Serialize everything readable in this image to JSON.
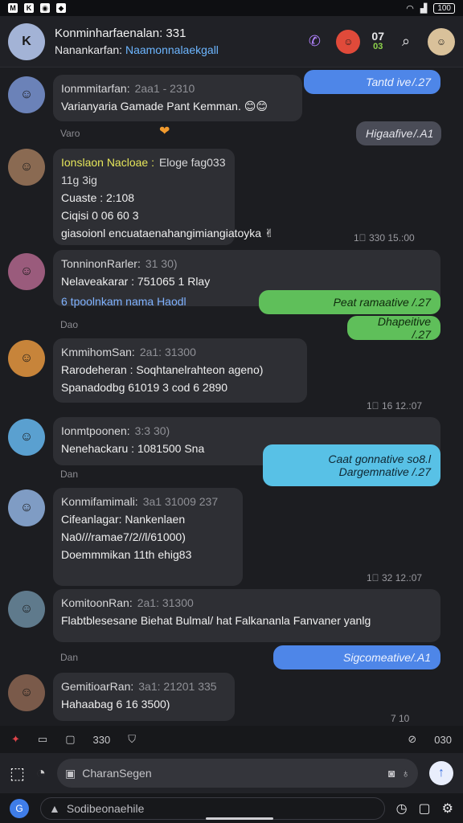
{
  "statusbar": {
    "icons": [
      "notification-icon",
      "notification-icon",
      "notification-icon",
      "notification-icon"
    ],
    "battery": "100"
  },
  "header": {
    "title": "Konminharfaenalan: 331",
    "subtitle_prefix": "Nanankarfan:",
    "subtitle_accent": "Naamonnalaekgall",
    "badge_top": "07",
    "badge_bottom": "03",
    "avatar_initials": "K"
  },
  "messages": [
    {
      "name": "Ionmmitarfan:",
      "time": "2aa1 - 2310",
      "lines": [
        "Varianyaria Gamade Pant Kemman. 😊😊"
      ]
    },
    {
      "name": "Ionslaon Nacloae :",
      "time": "Eloge fag033   11g 3ig",
      "lines": [
        "Cuaste : 2:108",
        "Ciqisi 0 06 60 3",
        "giasoionl encuataenahangimiangiatoyka ✌"
      ],
      "meta": "1⃝ 330 15.:00"
    },
    {
      "name": "TonninonRarler:",
      "time": "31 30)",
      "lines": [
        "Nelaveakarar : 751065 1 Rlay",
        "6 tpoolnkam nama Haodl"
      ]
    },
    {
      "name": "KmmihomSan:",
      "time": "2a1: 31300",
      "lines": [
        "Rarodeheran : Soqhtanelrahteon ageno)",
        "Spanadodbg 61019 3 cod 6 2890"
      ],
      "meta": "1⃝ 16 12.:07"
    },
    {
      "name": "Ionmtpoonen:",
      "time": "3:3 30)",
      "lines": [
        "Nenehackaru : 1081500 Sna"
      ]
    },
    {
      "name": "Konmifamimali:",
      "time": "3a1 31009 237",
      "lines": [
        "Cifeanlagar: Nankenlaen",
        "Na0///ramae7/2//l/61000)",
        "Doemmmikan 11th ehig83"
      ],
      "meta": "1⃝ 32 12.:07"
    },
    {
      "name": "KomitoonRan:",
      "time": "2a1: 31300",
      "lines": [
        "Flabtblesesane Biehat Bulmal/ hat Falkananla Fanvaner yanlg"
      ]
    },
    {
      "name": "GemitioarRan:",
      "time": "3a1: 21201 335",
      "lines": [
        "Hahaabag 6 16 3500)"
      ],
      "meta": "7 10"
    }
  ],
  "outgoing": [
    "Tantd ive /.27",
    "Higaafive /.A1",
    "Peat ramaative /.27",
    "Dhapeitive /.27",
    "Caat gonnative so8.l",
    "Dargemnative /.27",
    "Sigcomeative/.A1"
  ],
  "daylabels": [
    "Varo",
    "Dao",
    "Dan",
    "Dan"
  ],
  "toolbar": {
    "count": "330",
    "timer": "030"
  },
  "composer": {
    "placeholder": "CharanSegen"
  },
  "navbar": {
    "search_placeholder": "Sodibeonaehile"
  },
  "colors": {
    "blue": "#4e86e8",
    "green": "#5fbf5a",
    "cyan": "#58c1e6",
    "gray": "#4a4c57",
    "background": "#1c1d21"
  }
}
